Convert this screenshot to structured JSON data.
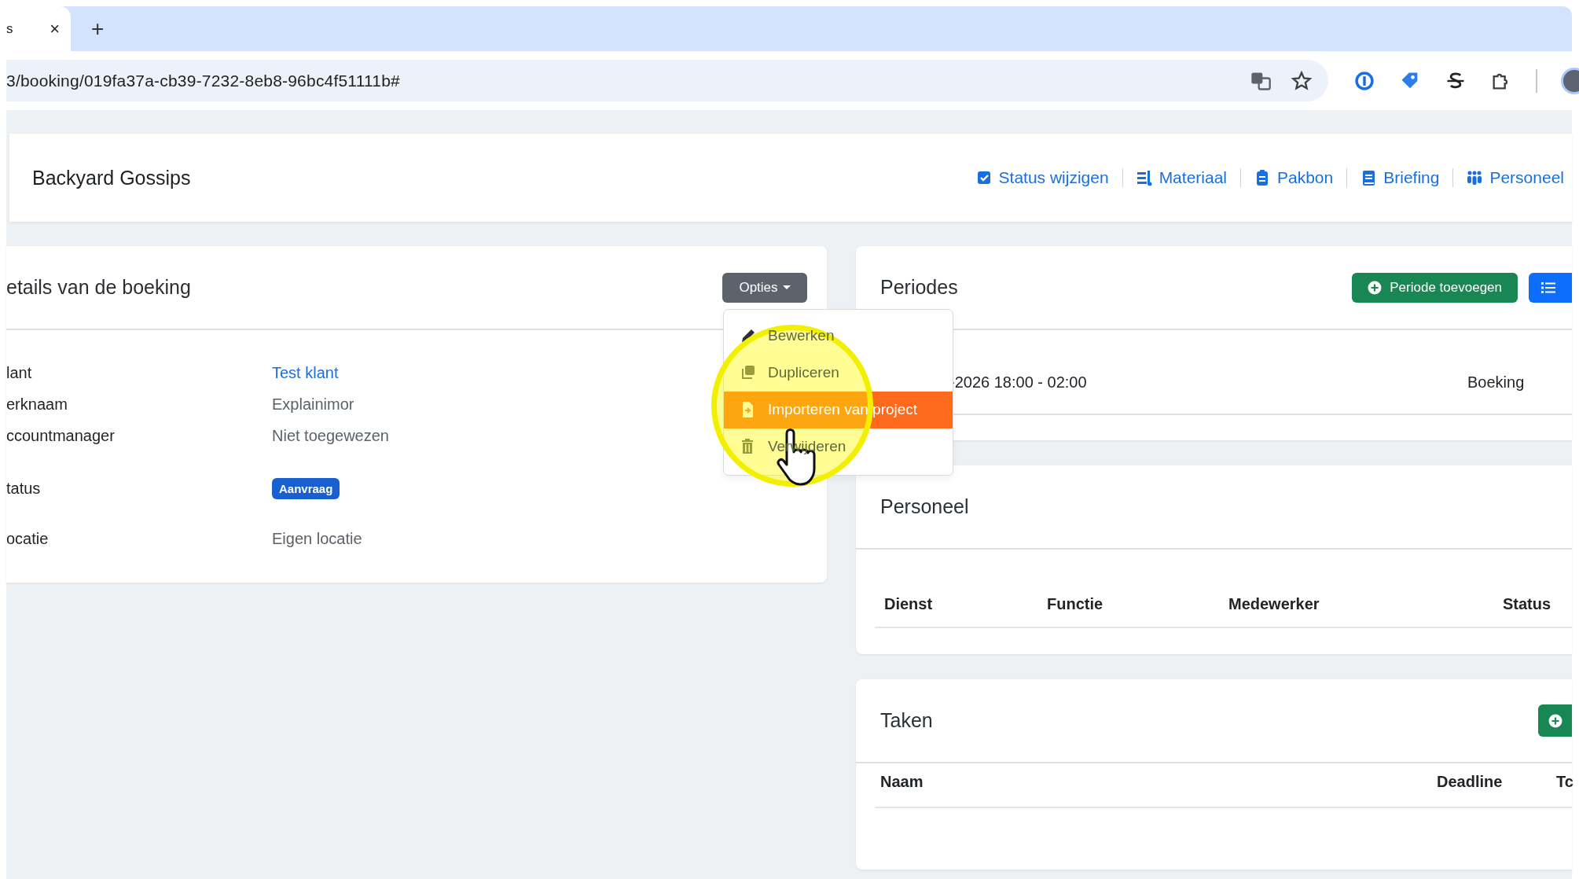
{
  "browser": {
    "tab": {
      "title": "s",
      "close": "×"
    },
    "new_tab": "+",
    "url": "3/booking/019fa37a-cb39-7232-8eb8-96bc4f51111b#"
  },
  "header": {
    "title": "Backyard Gossips",
    "actions": [
      {
        "label": "Status wijzigen"
      },
      {
        "label": "Materiaal"
      },
      {
        "label": "Pakbon"
      },
      {
        "label": "Briefing"
      },
      {
        "label": "Personeel"
      }
    ]
  },
  "details": {
    "title": "etails van de boeking",
    "options_button": "Opties",
    "fields": [
      {
        "label": "lant",
        "value": "Test klant",
        "kind": "link"
      },
      {
        "label": "erknaam",
        "value": "Explainimor",
        "kind": "text"
      },
      {
        "label": "ccountmanager",
        "value": "Niet toegewezen",
        "kind": "text"
      },
      {
        "label": "tatus",
        "value": "Aanvraag",
        "kind": "badge"
      },
      {
        "label": "ocatie",
        "value": "Eigen locatie",
        "kind": "text"
      }
    ],
    "menu": [
      {
        "label": "Bewerken",
        "selected": false
      },
      {
        "label": "Dupliceren",
        "selected": false
      },
      {
        "label": "Importeren van project",
        "selected": true
      },
      {
        "label": "Verwijderen",
        "selected": false
      }
    ]
  },
  "periodes": {
    "title": "Periodes",
    "add_button": "Periode toevoegen",
    "rows": [
      {
        "column_1": "-2026 18:00 - 02:00",
        "column_2": "Boeking"
      }
    ]
  },
  "personeel": {
    "title": "Personeel",
    "columns": [
      "Dienst",
      "Functie",
      "Medewerker",
      "Status"
    ]
  },
  "taken": {
    "title": "Taken",
    "columns": [
      "Naam",
      "Deadline",
      "Tc"
    ]
  }
}
